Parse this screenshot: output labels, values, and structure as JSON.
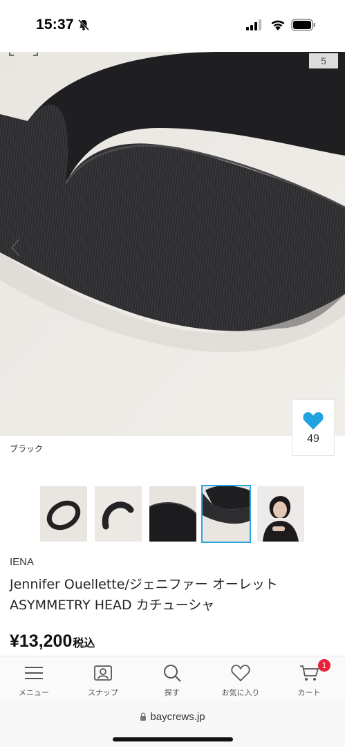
{
  "status_bar": {
    "time": "15:37",
    "icons": [
      "bell-slash-icon",
      "cellular-signal-icon",
      "wifi-icon",
      "battery-icon"
    ]
  },
  "gallery": {
    "page_indicator": "5",
    "color_label": "ブラック",
    "favorite_count": "49",
    "favorite_color": "#1fa3e0",
    "thumbnails": [
      {
        "name": "thumb-headband-black-1",
        "selected": false
      },
      {
        "name": "thumb-headband-black-2",
        "selected": false
      },
      {
        "name": "thumb-headband-logo-detail",
        "selected": false
      },
      {
        "name": "thumb-headband-closeup",
        "selected": true
      },
      {
        "name": "thumb-model-wearing",
        "selected": false
      }
    ],
    "selected_color": "#2aa6da"
  },
  "product": {
    "brand": "IENA",
    "title": "Jennifer Ouellette/ジェニファー オーレット ASYMMETRY HEAD カチューシャ",
    "price": "¥13,200",
    "tax_label": "税込"
  },
  "bottom_nav": {
    "items": [
      {
        "label": "メニュー",
        "icon": "menu-icon"
      },
      {
        "label": "スナップ",
        "icon": "snap-icon"
      },
      {
        "label": "探す",
        "icon": "search-icon"
      },
      {
        "label": "お気に入り",
        "icon": "heart-outline-icon"
      },
      {
        "label": "カート",
        "icon": "cart-icon"
      }
    ],
    "cart_badge": "1",
    "badge_color": "#e8203a"
  },
  "browser": {
    "url": "baycrews.jp"
  }
}
